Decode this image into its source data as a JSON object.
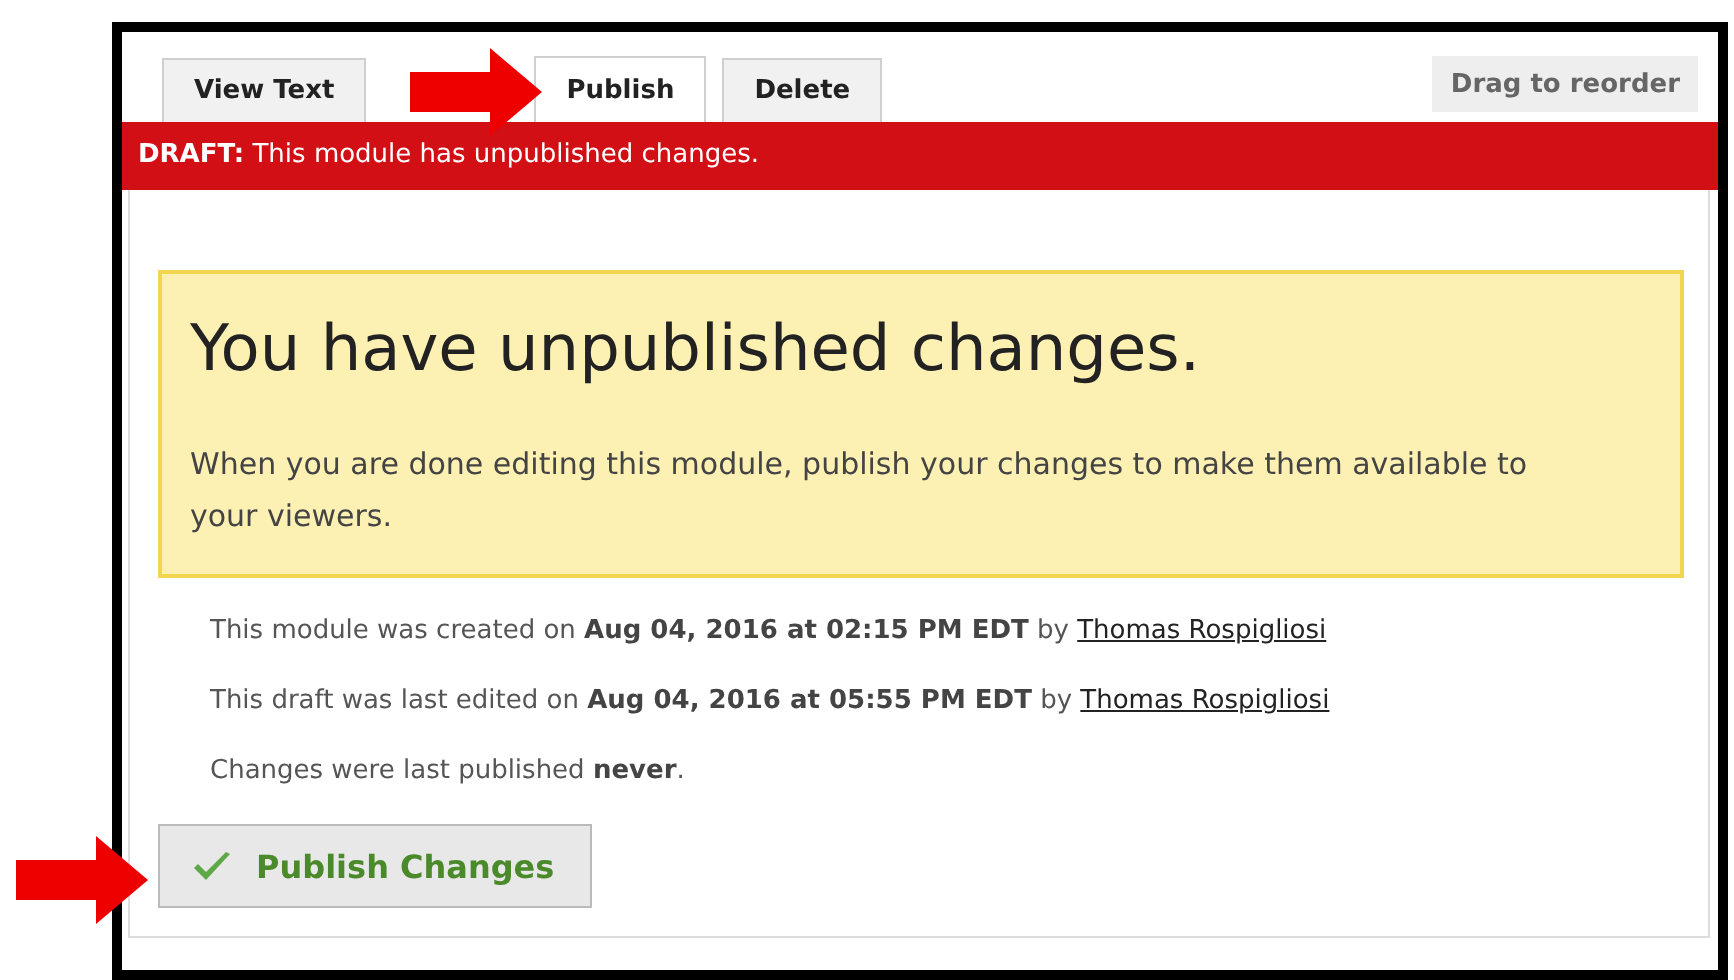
{
  "tabs": [
    {
      "label": "View Text",
      "selected": false
    },
    {
      "label": "Publish",
      "selected": true
    },
    {
      "label": "Delete",
      "selected": false
    }
  ],
  "drag_button": "Drag to reorder",
  "banner": "**DRAFT:** This module has unpublished changes.",
  "notice": {
    "title": "You have unpublished changes.",
    "body": "When you are done editing this module, publish your changes to make them available to your viewers."
  },
  "meta": [
    {
      "text": "This module was created on **Aug 04, 2016 at 02:15 PM EDT** by",
      "link": "Thomas Rospigliosi"
    },
    {
      "text": "This draft was last edited on **Aug 04, 2016 at 05:55 PM EDT** by",
      "link": "Thomas Rospigliosi"
    },
    {
      "text": "Changes were last published **never**."
    }
  ],
  "publish_button": "Publish Changes"
}
